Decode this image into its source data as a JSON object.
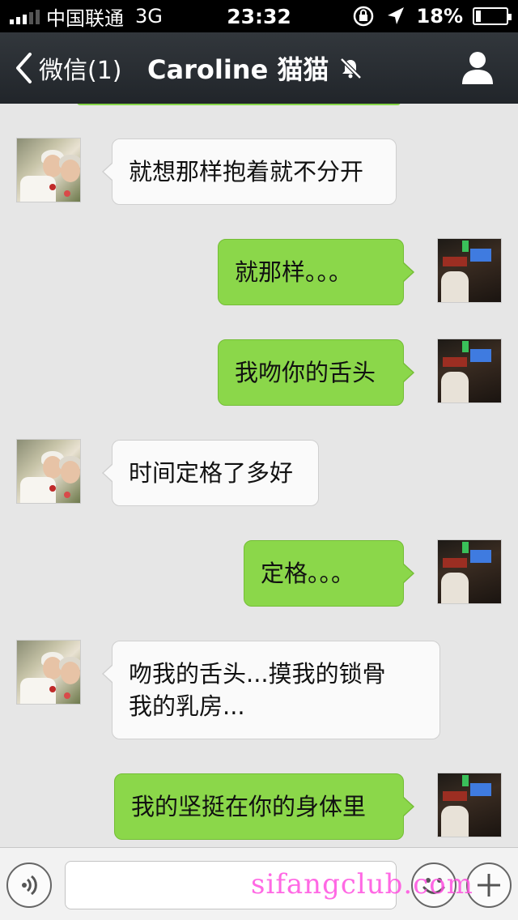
{
  "status_bar": {
    "carrier": "中国联通",
    "network": "3G",
    "time": "23:32",
    "battery_percent": "18%",
    "battery_level": 0.18
  },
  "nav": {
    "back_label": "微信(1)",
    "title": "Caroline 猫猫"
  },
  "messages": [
    {
      "side": "left",
      "text": "就想那样抱着就不分开"
    },
    {
      "side": "right",
      "text": "就那样。。。"
    },
    {
      "side": "right",
      "text": "我吻你的舌头"
    },
    {
      "side": "left",
      "text": "时间定格了多好"
    },
    {
      "side": "right",
      "text": "定格。。。"
    },
    {
      "side": "left",
      "text": "吻我的舌头...摸我的锁骨\n我的乳房..."
    },
    {
      "side": "right",
      "text": "我的坚挺在你的身体里"
    }
  ],
  "input": {
    "value": "",
    "placeholder": ""
  },
  "watermark": "sifangclub.com",
  "colors": {
    "bubble_outgoing": "#8bd74a",
    "bubble_incoming": "#fafafa",
    "nav_bg": "#272b30",
    "chat_bg": "#e6e6e6"
  }
}
